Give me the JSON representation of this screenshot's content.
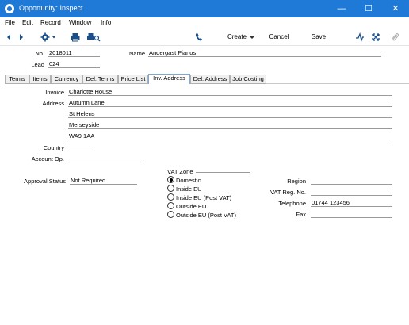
{
  "window": {
    "title": "Opportunity: Inspect"
  },
  "menu": [
    "File",
    "Edit",
    "Record",
    "Window",
    "Info"
  ],
  "toolbar": {
    "create_label": "Create",
    "cancel_label": "Cancel",
    "save_label": "Save"
  },
  "header": {
    "no_label": "No.",
    "no_value": "2018011",
    "name_label": "Name",
    "name_value": "Andergast Pianos",
    "lead_label": "Lead",
    "lead_value": "024"
  },
  "tabs": [
    "Terms",
    "Items",
    "Currency",
    "Del. Terms",
    "Price List",
    "Inv. Address",
    "Del. Address",
    "Job Costing"
  ],
  "invaddr": {
    "invoice_label": "Invoice",
    "invoice_value": "Charlotte House",
    "address_label": "Address",
    "address_lines": [
      "Autumn Lane",
      "St Helens",
      "Merseyside",
      "WA9 1AA"
    ],
    "country_label": "Country",
    "country_value": "",
    "account_label": "Account Op.",
    "account_value": "",
    "approval_label": "Approval Status",
    "approval_value": "Not Required",
    "vatzone_label": "VAT Zone",
    "vatzone_options": [
      "Domestic",
      "Inside EU",
      "Inside EU (Post VAT)",
      "Outside EU",
      "Outside EU (Post VAT)"
    ],
    "vatzone_selected": "Domestic",
    "region_label": "Region",
    "region_value": "",
    "vatreg_label": "VAT Reg. No.",
    "vatreg_value": "",
    "telephone_label": "Telephone",
    "telephone_value": "01744 123456",
    "fax_label": "Fax",
    "fax_value": ""
  }
}
